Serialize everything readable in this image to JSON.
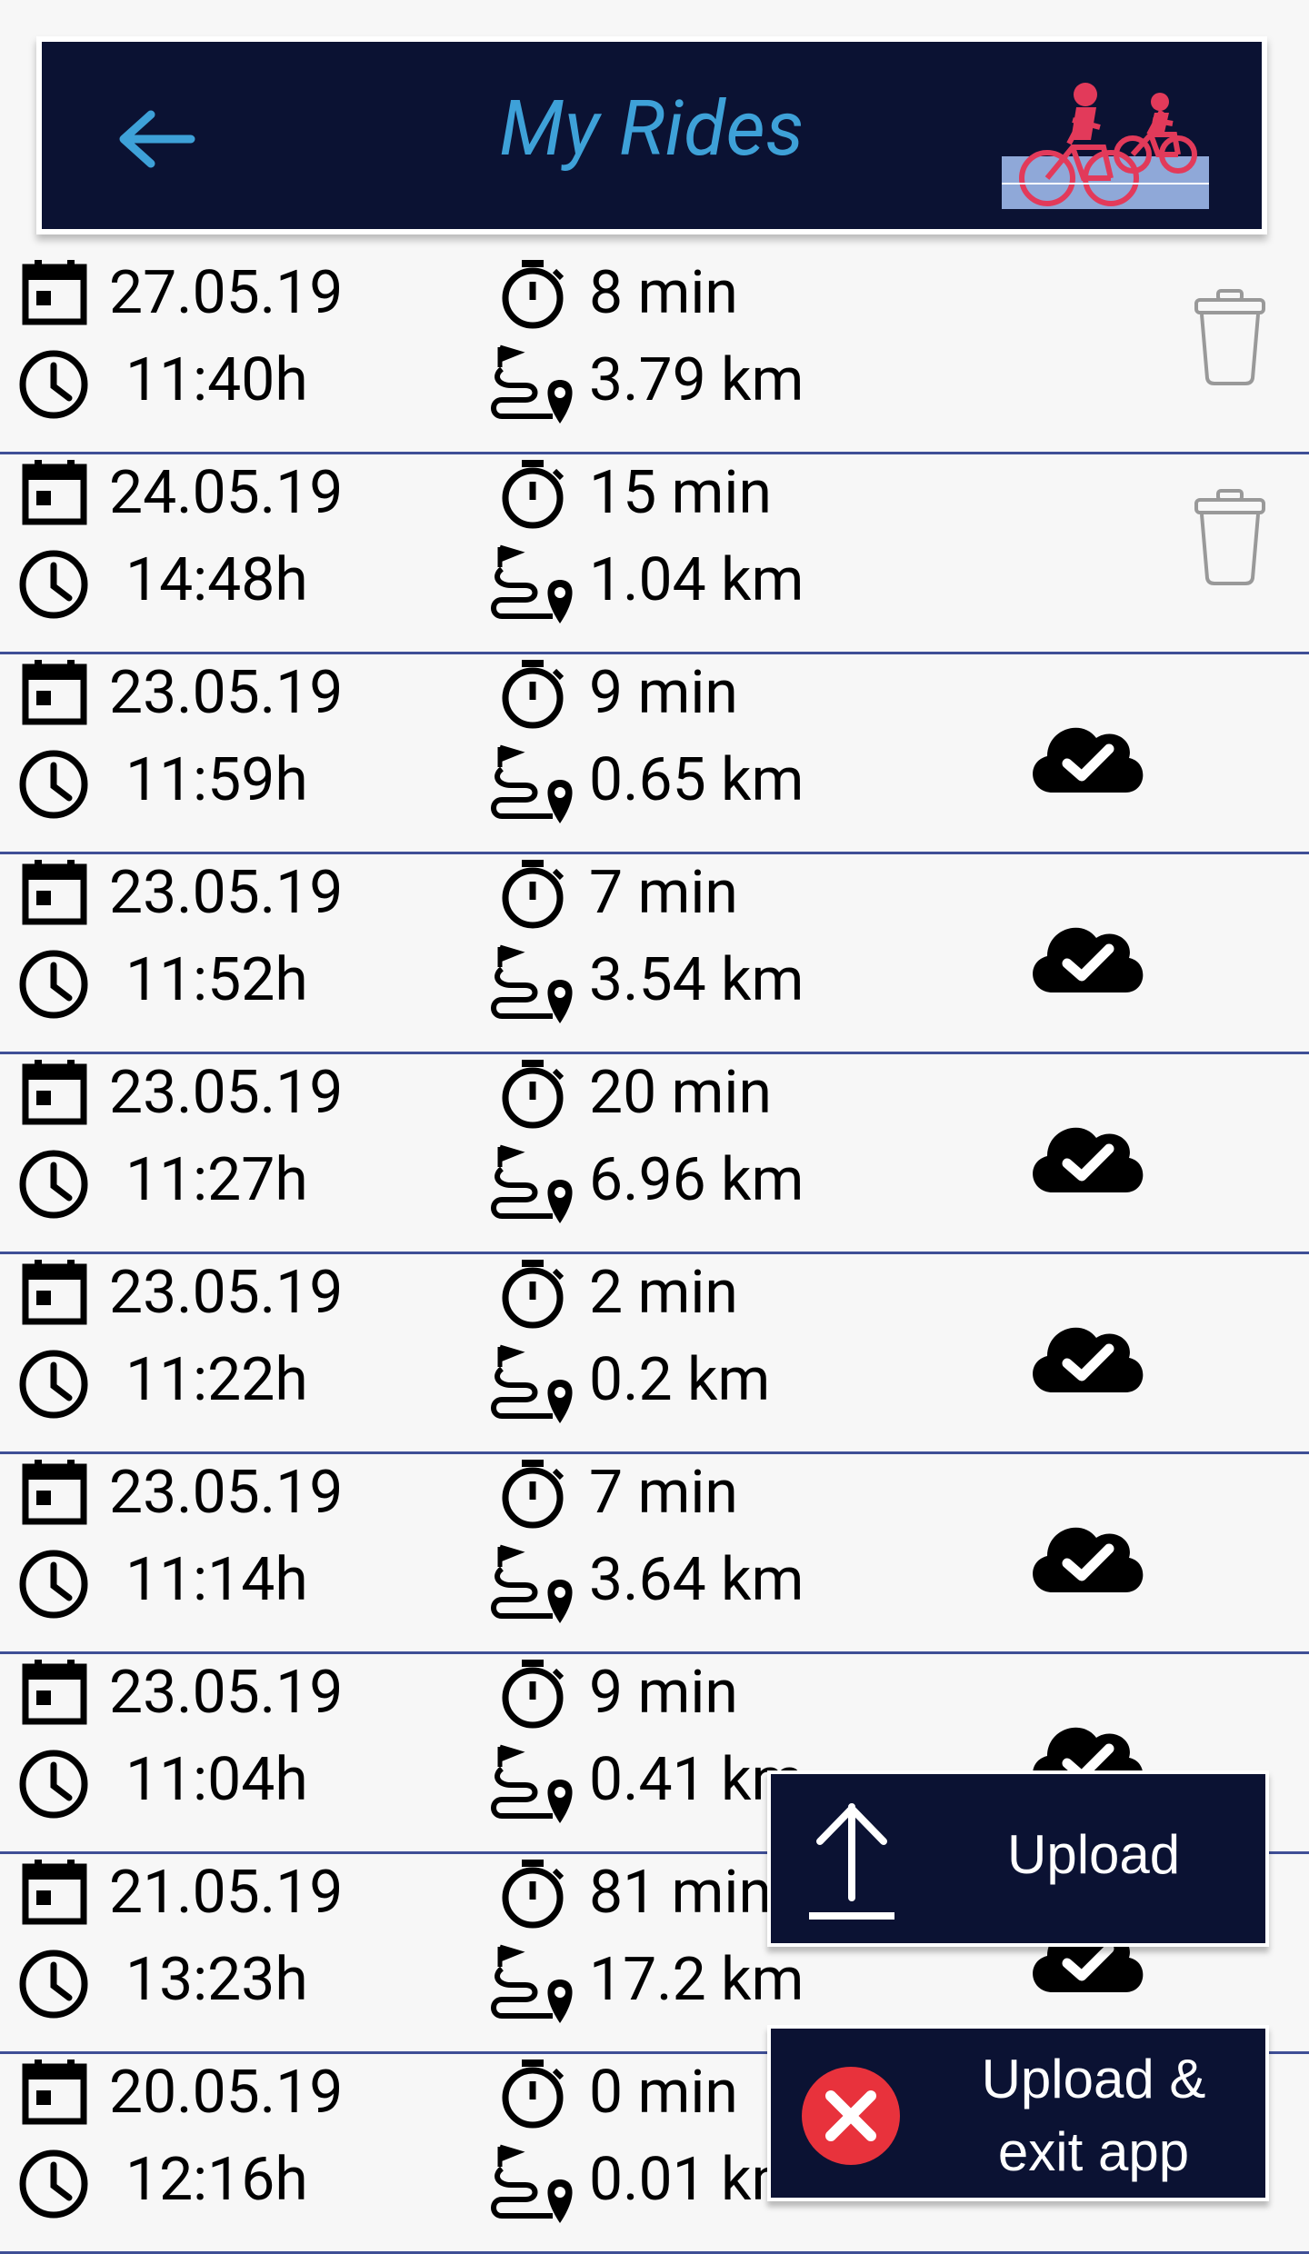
{
  "header": {
    "title": "My Rides",
    "title_color": "#3ea1d8",
    "background": "#0b1233",
    "back_icon": "arrow-left-icon",
    "logo": "cyclists-logo"
  },
  "rides": [
    {
      "date": "27.05.19",
      "time": "11:40h",
      "duration": "8 min",
      "distance": "3.79 km",
      "status": "trash"
    },
    {
      "date": "24.05.19",
      "time": "14:48h",
      "duration": "15 min",
      "distance": "1.04 km",
      "status": "trash"
    },
    {
      "date": "23.05.19",
      "time": "11:59h",
      "duration": "9 min",
      "distance": "0.65 km",
      "status": "uploaded"
    },
    {
      "date": "23.05.19",
      "time": "11:52h",
      "duration": "7 min",
      "distance": "3.54 km",
      "status": "uploaded"
    },
    {
      "date": "23.05.19",
      "time": "11:27h",
      "duration": "20 min",
      "distance": "6.96 km",
      "status": "uploaded"
    },
    {
      "date": "23.05.19",
      "time": "11:22h",
      "duration": "2 min",
      "distance": "0.2 km",
      "status": "uploaded"
    },
    {
      "date": "23.05.19",
      "time": "11:14h",
      "duration": "7 min",
      "distance": "3.64 km",
      "status": "uploaded"
    },
    {
      "date": "23.05.19",
      "time": "11:04h",
      "duration": "9 min",
      "distance": "0.41 km",
      "status": "uploaded"
    },
    {
      "date": "21.05.19",
      "time": "13:23h",
      "duration": "81 min",
      "distance": "17.2 km",
      "status": "uploaded"
    },
    {
      "date": "20.05.19",
      "time": "12:16h",
      "duration": "0 min",
      "distance": "0.01 km",
      "status": "uploaded"
    }
  ],
  "icons": {
    "date": "calendar-icon",
    "time": "clock-icon",
    "duration": "stopwatch-icon",
    "distance": "route-icon",
    "delete": "trash-icon",
    "uploaded": "cloud-check-icon"
  },
  "actions": {
    "upload_label": "Upload",
    "upload_icon": "upload-arrow-icon",
    "upload_exit_label": "Upload & exit app",
    "upload_exit_icon": "close-circle-icon",
    "exit_icon_color": "#e8323c"
  },
  "colors": {
    "divider": "#3f4f96",
    "dark_navy": "#0b1233"
  }
}
